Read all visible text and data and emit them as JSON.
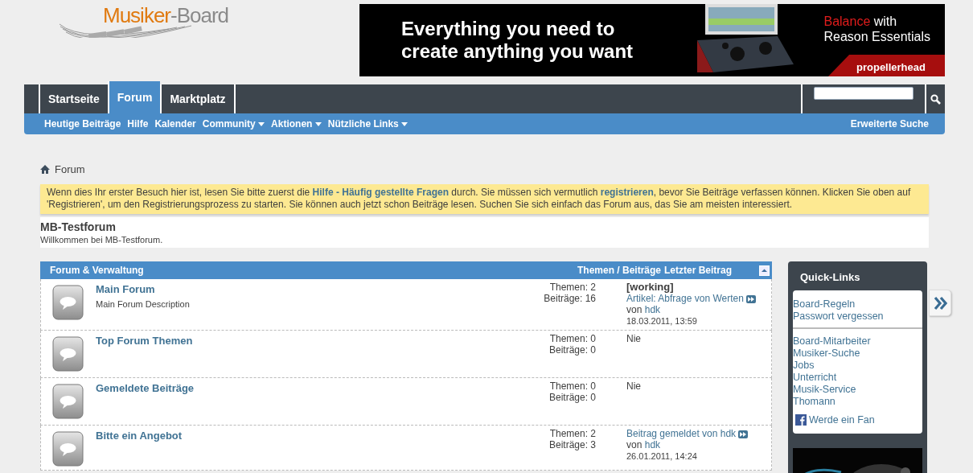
{
  "logo": {
    "part1": "Musiker",
    "part2": "-Board"
  },
  "ad": {
    "headline1": "Everything you need to",
    "headline2": "create anything you want",
    "accent": "Balance",
    "tagline1": " with",
    "tagline2": "Reason Essentials",
    "brand": "propellerhead"
  },
  "tabs": [
    {
      "label": "Startseite",
      "selected": false
    },
    {
      "label": "Forum",
      "selected": true
    },
    {
      "label": "Marktplatz",
      "selected": false
    }
  ],
  "subnav": [
    {
      "label": "Heutige Beiträge",
      "dropdown": false
    },
    {
      "label": "Hilfe",
      "dropdown": false
    },
    {
      "label": "Kalender",
      "dropdown": false
    },
    {
      "label": "Community",
      "dropdown": true
    },
    {
      "label": "Aktionen",
      "dropdown": true
    },
    {
      "label": "Nützliche Links",
      "dropdown": true
    }
  ],
  "advanced_search": "Erweiterte Suche",
  "breadcrumb": "Forum",
  "notice": "Wenn dies Ihr erster Besuch hier ist, lesen Sie bitte zuerst die **Hilfe - Häufig gestellte Fragen** durch. Sie müssen sich vermutlich **registrieren**, bevor Sie Beiträge verfassen können. Klicken Sie oben auf 'Registrieren', um den Registrierungsprozess zu starten. Sie können auch jetzt schon Beiträge lesen. Suchen Sie sich einfach das Forum aus, das Sie am meisten interessiert.",
  "forum_title": "MB-Testforum",
  "forum_welcome": "Willkommen bei MB-Testforum.",
  "table": {
    "columns": [
      "Forum & Verwaltung",
      "Themen / Beiträge",
      "Letzter Beitrag"
    ],
    "rows": [
      {
        "title": "Main Forum",
        "description": "Main Forum Description",
        "threads": "Themen: 2",
        "posts": "Beiträge: 16",
        "last_post": {
          "kind": "post",
          "prefix": "[working]",
          "title": "Artikel: Abfrage von Werten",
          "by": "von",
          "author": "hdk",
          "date": "18.03.2011, 13:59"
        }
      },
      {
        "title": "Top Forum Themen",
        "threads": "Themen: 0",
        "posts": "Beiträge: 0",
        "last_post": {
          "kind": "none",
          "text": "Nie"
        }
      },
      {
        "title": "Gemeldete Beiträge",
        "threads": "Themen: 0",
        "posts": "Beiträge: 0",
        "last_post": {
          "kind": "none",
          "text": "Nie"
        }
      },
      {
        "title": "Bitte ein Angebot",
        "threads": "Themen: 2",
        "posts": "Beiträge: 3",
        "last_post": {
          "kind": "post",
          "title": "Beitrag gemeldet von hdk",
          "by": "von",
          "author": "hdk",
          "date": "26.01.2011, 14:24"
        }
      }
    ]
  },
  "sidebar": {
    "title": "Quick-Links",
    "groups": [
      [
        "Board-Regeln",
        "Passwort vergessen"
      ],
      [
        "Board-Mitarbeiter",
        "Musiker-Suche",
        "Jobs",
        "Unterricht",
        "Musik-Service",
        "Thomann"
      ]
    ],
    "fan": "Werde ein Fan"
  }
}
